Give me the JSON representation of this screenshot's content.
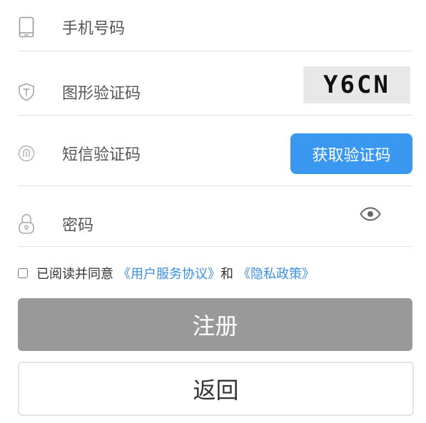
{
  "form": {
    "phone": {
      "placeholder": "手机号码",
      "value": "",
      "icon": "phone-icon"
    },
    "captcha": {
      "placeholder": "图形验证码",
      "value": "",
      "icon": "shield-icon",
      "code": "Y6CN"
    },
    "sms": {
      "placeholder": "短信验证码",
      "value": "",
      "icon": "sms-code-icon",
      "button_label": "获取验证码"
    },
    "password": {
      "placeholder": "密码",
      "value": "",
      "icon": "lock-icon",
      "toggle_icon": "eye-icon"
    }
  },
  "agreement": {
    "checked": false,
    "prefix": "已阅读并同意",
    "terms_link": "《用户服务协议》",
    "conjunction": "和",
    "privacy_link": "《隐私政策》"
  },
  "actions": {
    "register_label": "注册",
    "back_label": "返回"
  },
  "colors": {
    "primary": "#3a98f0",
    "link": "#3a8ee6",
    "register_disabled": "#999999",
    "divider": "#e0e0e0",
    "captcha_bg": "#e8e8e8"
  }
}
